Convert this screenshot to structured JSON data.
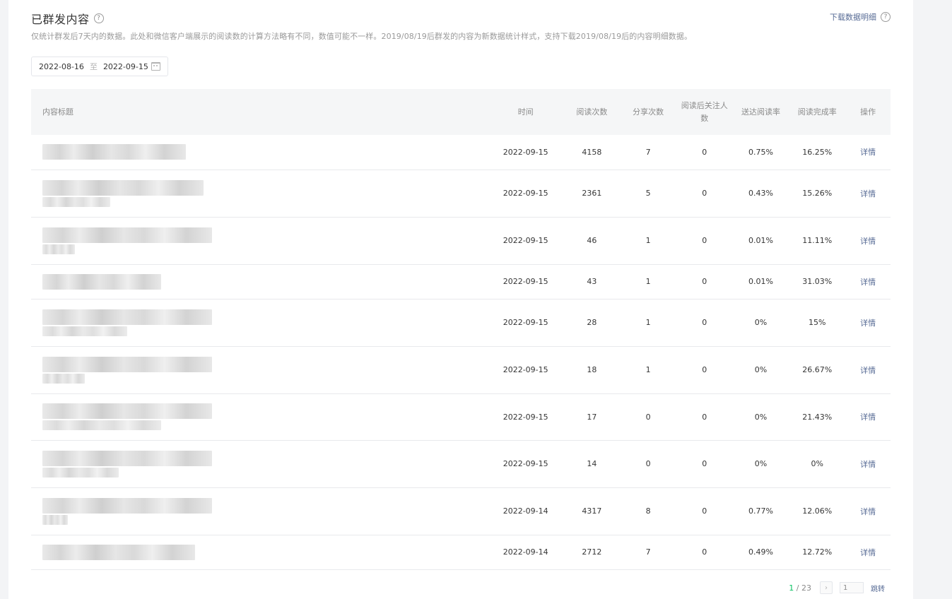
{
  "header": {
    "title": "已群发内容",
    "help_icon": "?",
    "download_label": "下载数据明细",
    "download_help_icon": "?"
  },
  "notice": "仅统计群发后7天内的数据。此处和微信客户端展示的阅读数的计算方法略有不同，数值可能不一样。2019/08/19后群发的内容为新数据统计样式，支持下载2019/08/19后的内容明细数据。",
  "date_range": {
    "start": "2022-08-16",
    "separator": "至",
    "end": "2022-09-15"
  },
  "table": {
    "columns": {
      "title": "内容标题",
      "time": "时间",
      "reads": "阅读次数",
      "shares": "分享次数",
      "follow_after_read": "阅读后关注人数",
      "reach_read_rate": "送达阅读率",
      "completion_rate": "阅读完成率",
      "action": "操作"
    },
    "rows": [
      {
        "time": "2022-09-15",
        "reads": "4158",
        "shares": "7",
        "follow": "0",
        "reach": "0.75%",
        "complete": "16.25%",
        "action": "详情",
        "title_lines": 1
      },
      {
        "time": "2022-09-15",
        "reads": "2361",
        "shares": "5",
        "follow": "0",
        "reach": "0.43%",
        "complete": "15.26%",
        "action": "详情",
        "title_lines": 2
      },
      {
        "time": "2022-09-15",
        "reads": "46",
        "shares": "1",
        "follow": "0",
        "reach": "0.01%",
        "complete": "11.11%",
        "action": "详情",
        "title_lines": 2
      },
      {
        "time": "2022-09-15",
        "reads": "43",
        "shares": "1",
        "follow": "0",
        "reach": "0.01%",
        "complete": "31.03%",
        "action": "详情",
        "title_lines": 1
      },
      {
        "time": "2022-09-15",
        "reads": "28",
        "shares": "1",
        "follow": "0",
        "reach": "0%",
        "complete": "15%",
        "action": "详情",
        "title_lines": 2
      },
      {
        "time": "2022-09-15",
        "reads": "18",
        "shares": "1",
        "follow": "0",
        "reach": "0%",
        "complete": "26.67%",
        "action": "详情",
        "title_lines": 2
      },
      {
        "time": "2022-09-15",
        "reads": "17",
        "shares": "0",
        "follow": "0",
        "reach": "0%",
        "complete": "21.43%",
        "action": "详情",
        "title_lines": 2
      },
      {
        "time": "2022-09-15",
        "reads": "14",
        "shares": "0",
        "follow": "0",
        "reach": "0%",
        "complete": "0%",
        "action": "详情",
        "title_lines": 2
      },
      {
        "time": "2022-09-14",
        "reads": "4317",
        "shares": "8",
        "follow": "0",
        "reach": "0.77%",
        "complete": "12.06%",
        "action": "详情",
        "title_lines": 2
      },
      {
        "time": "2022-09-14",
        "reads": "2712",
        "shares": "7",
        "follow": "0",
        "reach": "0.49%",
        "complete": "12.72%",
        "action": "详情",
        "title_lines": 1
      }
    ]
  },
  "pagination": {
    "current": "1",
    "total": "23",
    "next_icon": "›",
    "input_value": "1",
    "jump_label": "跳转"
  },
  "icons": {
    "help": "help-circle-icon",
    "calendar": "calendar-icon",
    "next": "chevron-right-icon"
  }
}
